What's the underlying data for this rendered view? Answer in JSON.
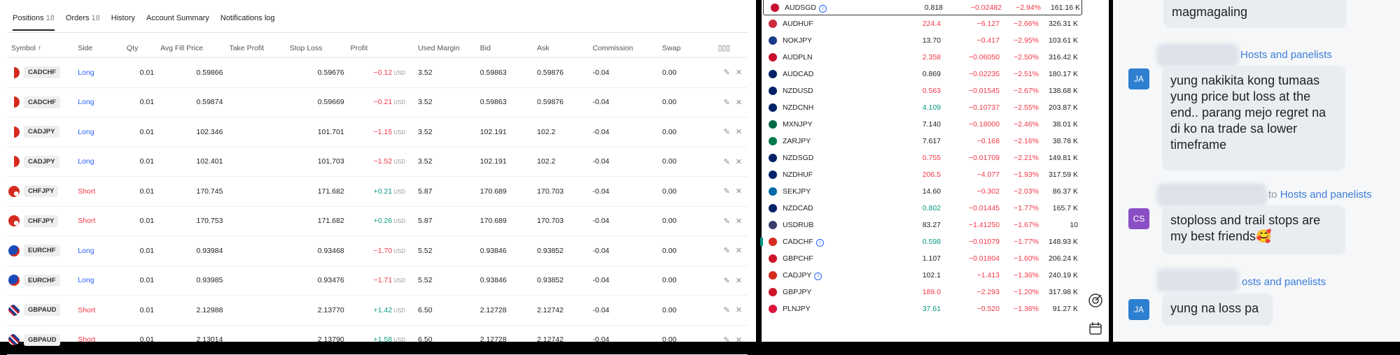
{
  "tabs": [
    {
      "label": "Positions",
      "count": "18"
    },
    {
      "label": "Orders",
      "count": "18"
    },
    {
      "label": "History",
      "count": ""
    },
    {
      "label": "Account Summary",
      "count": ""
    },
    {
      "label": "Notifications log",
      "count": ""
    }
  ],
  "columns": [
    "Symbol ↑",
    "Side",
    "Qty",
    "Avg Fill Price",
    "Take Profit",
    "Stop Loss",
    "Profit",
    "Used Margin",
    "Bid",
    "Ask",
    "Commission",
    "Swap"
  ],
  "positions": [
    {
      "symbol": "CADCHF",
      "side": "Long",
      "qty": "0.01",
      "avg": "0.59866",
      "tp": "",
      "sl": "0.59676",
      "profit": "−0.12",
      "unit": "USD",
      "margin": "3.52",
      "bid": "0.59863",
      "ask": "0.59876",
      "comm": "-0.04",
      "swap": "0.00"
    },
    {
      "symbol": "CADCHF",
      "side": "Long",
      "qty": "0.01",
      "avg": "0.59874",
      "tp": "",
      "sl": "0.59669",
      "profit": "−0.21",
      "unit": "USD",
      "margin": "3.52",
      "bid": "0.59863",
      "ask": "0.59876",
      "comm": "-0.04",
      "swap": "0.00"
    },
    {
      "symbol": "CADJPY",
      "side": "Long",
      "qty": "0.01",
      "avg": "102.346",
      "tp": "",
      "sl": "101.701",
      "profit": "−1.15",
      "unit": "USD",
      "margin": "3.52",
      "bid": "102.191",
      "ask": "102.2",
      "comm": "-0.04",
      "swap": "0.00"
    },
    {
      "symbol": "CADJPY",
      "side": "Long",
      "qty": "0.01",
      "avg": "102.401",
      "tp": "",
      "sl": "101.703",
      "profit": "−1.52",
      "unit": "USD",
      "margin": "3.52",
      "bid": "102.191",
      "ask": "102.2",
      "comm": "-0.04",
      "swap": "0.00"
    },
    {
      "symbol": "CHFJPY",
      "side": "Short",
      "qty": "0.01",
      "avg": "170.745",
      "tp": "",
      "sl": "171.682",
      "profit": "+0.21",
      "unit": "USD",
      "margin": "5.87",
      "bid": "170.689",
      "ask": "170.703",
      "comm": "-0.04",
      "swap": "0.00"
    },
    {
      "symbol": "CHFJPY",
      "side": "Short",
      "qty": "0.01",
      "avg": "170.753",
      "tp": "",
      "sl": "171.682",
      "profit": "+0.26",
      "unit": "USD",
      "margin": "5.87",
      "bid": "170.689",
      "ask": "170.703",
      "comm": "-0.04",
      "swap": "0.00"
    },
    {
      "symbol": "EURCHF",
      "side": "Long",
      "qty": "0.01",
      "avg": "0.93984",
      "tp": "",
      "sl": "0.93468",
      "profit": "−1.70",
      "unit": "USD",
      "margin": "5.52",
      "bid": "0.93846",
      "ask": "0.93852",
      "comm": "-0.04",
      "swap": "0.00"
    },
    {
      "symbol": "EURCHF",
      "side": "Long",
      "qty": "0.01",
      "avg": "0.93985",
      "tp": "",
      "sl": "0.93476",
      "profit": "−1.71",
      "unit": "USD",
      "margin": "5.52",
      "bid": "0.93846",
      "ask": "0.93852",
      "comm": "-0.04",
      "swap": "0.00"
    },
    {
      "symbol": "GBPAUD",
      "side": "Short",
      "qty": "0.01",
      "avg": "2.12988",
      "tp": "",
      "sl": "2.13770",
      "profit": "+1.42",
      "unit": "USD",
      "margin": "6.50",
      "bid": "2.12728",
      "ask": "2.12742",
      "comm": "-0.04",
      "swap": "0.00"
    },
    {
      "symbol": "GBPAUD",
      "side": "Short",
      "qty": "0.01",
      "avg": "2.13014",
      "tp": "",
      "sl": "2.13790",
      "profit": "+1.58",
      "unit": "USD",
      "margin": "6.50",
      "bid": "2.12728",
      "ask": "2.12742",
      "comm": "-0.04",
      "swap": "0.00"
    }
  ],
  "watchlist": [
    {
      "sym": "AUDSGD",
      "info": "i",
      "last": "0.818",
      "chg": "−0.02482",
      "chgp": "−2.94%",
      "vol": "161.16 K",
      "last_color": "#222"
    },
    {
      "sym": "AUDHUF",
      "info": "",
      "last": "224.4",
      "chg": "−6.127",
      "chgp": "−2.66%",
      "vol": "326.31 K",
      "last_color": "#f23645"
    },
    {
      "sym": "NOKJPY",
      "info": "",
      "last": "13.70",
      "chg": "−0.417",
      "chgp": "−2.95%",
      "vol": "103.61 K",
      "last_color": "#222"
    },
    {
      "sym": "AUDPLN",
      "info": "",
      "last": "2.358",
      "chg": "−0.06050",
      "chgp": "−2.50%",
      "vol": "316.42 K",
      "last_color": "#f23645"
    },
    {
      "sym": "AUDCAD",
      "info": "",
      "last": "0.869",
      "chg": "−0.02235",
      "chgp": "−2.51%",
      "vol": "180.17 K",
      "last_color": "#222"
    },
    {
      "sym": "NZDUSD",
      "info": "",
      "last": "0.563",
      "chg": "−0.01545",
      "chgp": "−2.67%",
      "vol": "138.68 K",
      "last_color": "#f23645"
    },
    {
      "sym": "NZDCNH",
      "info": "",
      "last": "4.109",
      "chg": "−0.10737",
      "chgp": "−2.55%",
      "vol": "203.87 K",
      "last_color": "#089981"
    },
    {
      "sym": "MXNJPY",
      "info": "",
      "last": "7.140",
      "chg": "−0.18000",
      "chgp": "−2.46%",
      "vol": "38.01 K",
      "last_color": "#222"
    },
    {
      "sym": "ZARJPY",
      "info": "",
      "last": "7.617",
      "chg": "−0.168",
      "chgp": "−2.16%",
      "vol": "38.78 K",
      "last_color": "#222"
    },
    {
      "sym": "NZDSGD",
      "info": "",
      "last": "0.755",
      "chg": "−0.01709",
      "chgp": "−2.21%",
      "vol": "149.81 K",
      "last_color": "#f23645"
    },
    {
      "sym": "NZDHUF",
      "info": "",
      "last": "206.5",
      "chg": "−4.077",
      "chgp": "−1.93%",
      "vol": "317.59 K",
      "last_color": "#f23645"
    },
    {
      "sym": "SEKJPY",
      "info": "",
      "last": "14.60",
      "chg": "−0.302",
      "chgp": "−2.03%",
      "vol": "86.37 K",
      "last_color": "#222"
    },
    {
      "sym": "NZDCAD",
      "info": "",
      "last": "0.802",
      "chg": "−0.01445",
      "chgp": "−1.77%",
      "vol": "165.7 K",
      "last_color": "#089981"
    },
    {
      "sym": "USDRUB",
      "info": "",
      "last": "83.27",
      "chg": "−1.41250",
      "chgp": "−1.67%",
      "vol": "10",
      "last_color": "#222"
    },
    {
      "sym": "CADCHF",
      "info": "i",
      "last": "0.598",
      "chg": "−0.01079",
      "chgp": "−1.77%",
      "vol": "148.93 K",
      "last_color": "#089981"
    },
    {
      "sym": "GBPCHF",
      "info": "",
      "last": "1.107",
      "chg": "−0.01804",
      "chgp": "−1.60%",
      "vol": "206.24 K",
      "last_color": "#222"
    },
    {
      "sym": "CADJPY",
      "info": "i",
      "last": "102.1",
      "chg": "−1.413",
      "chgp": "−1.36%",
      "vol": "240.19 K",
      "last_color": "#222"
    },
    {
      "sym": "GBPJPY",
      "info": "",
      "last": "189.0",
      "chg": "−2.293",
      "chgp": "−1.20%",
      "vol": "317.98 K",
      "last_color": "#f23645"
    },
    {
      "sym": "PLNJPY",
      "info": "",
      "last": "37.61",
      "chg": "−0.520",
      "chgp": "−1.36%",
      "vol": "91.27 K",
      "last_color": "#089981"
    }
  ],
  "chat": {
    "top_bubble": "magmagaling",
    "messages": [
      {
        "initials": "JA",
        "avatar_color": "#2d7fd0",
        "to_prefix": "",
        "to": "Hosts and panelists",
        "text": "yung nakikita kong tumaas yung price but loss at the end.. parang mejo regret na di ko na trade sa lower timeframe"
      },
      {
        "initials": "CS",
        "avatar_color": "#8a4fc4",
        "to_prefix": "to",
        "to": "Hosts and panelists",
        "text": "stoploss and trail stops are my best friends🥰"
      },
      {
        "initials": "JA",
        "avatar_color": "#2d7fd0",
        "to_prefix": "",
        "to": "osts and panelists",
        "text": "yung na loss pa"
      }
    ]
  }
}
